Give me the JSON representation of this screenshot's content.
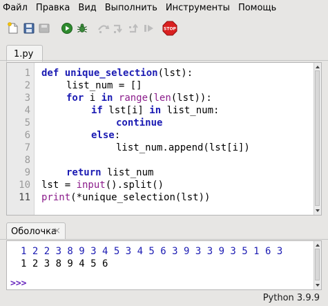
{
  "menu": [
    "Файл",
    "Правка",
    "Вид",
    "Выполнить",
    "Инструменты",
    "Помощь"
  ],
  "toolbar": {
    "buttons": [
      "new-file",
      "save",
      "save-disabled",
      "run",
      "debug",
      "step-over",
      "step-into",
      "step-out",
      "resume",
      "stop"
    ],
    "stop_label": "STOP"
  },
  "editor": {
    "tab_label": "1.py",
    "lines": [
      {
        "no": "1"
      },
      {
        "no": "2"
      },
      {
        "no": "3"
      },
      {
        "no": "4"
      },
      {
        "no": "5"
      },
      {
        "no": "6"
      },
      {
        "no": "7"
      },
      {
        "no": "8"
      },
      {
        "no": "9"
      },
      {
        "no": "10"
      },
      {
        "no": "11"
      }
    ],
    "current_line": "11",
    "code": {
      "l1_def": "def",
      "l1_name": "unique_selection",
      "l1_rest": "(lst):",
      "l2": "list_num = []",
      "l3_for": "for",
      "l3_i": " i ",
      "l3_in": "in",
      "l3_range": "range",
      "l3_paren": "(",
      "l3_len": "len",
      "l3_rest": "(lst)):",
      "l4_if": "if",
      "l4_mid": " lst[i] ",
      "l4_in": "in",
      "l4_rest": " list_num:",
      "l5": "continue",
      "l6": "else",
      "l6_colon": ":",
      "l7": "list_num.append(lst[i])",
      "l9_return": "return",
      "l9_rest": " list_num",
      "l10_pre": "lst = ",
      "l10_input": "input",
      "l10_rest": "().split()",
      "l11_print": "print",
      "l11_rest": "(*unique_selection(lst))"
    }
  },
  "shell": {
    "tab_label": "Оболочка",
    "close_glyph": "×",
    "input_line": "1 2 2 3 8 9 3 4 5 3 4 5 6 3 9 3 3 9 3 5 1 6 3",
    "output_line": "1 2 3 8 9 4 5 6",
    "prompt": ">>>"
  },
  "status": {
    "python_version": "Python 3.9.9"
  },
  "colors": {
    "keyword": "#1b1bb3",
    "builtin": "#8b1c8b",
    "prompt": "#6b2bc0",
    "shell_input": "#1b1bb3",
    "run_green": "#2e8b2e",
    "stop_red": "#d92020"
  }
}
